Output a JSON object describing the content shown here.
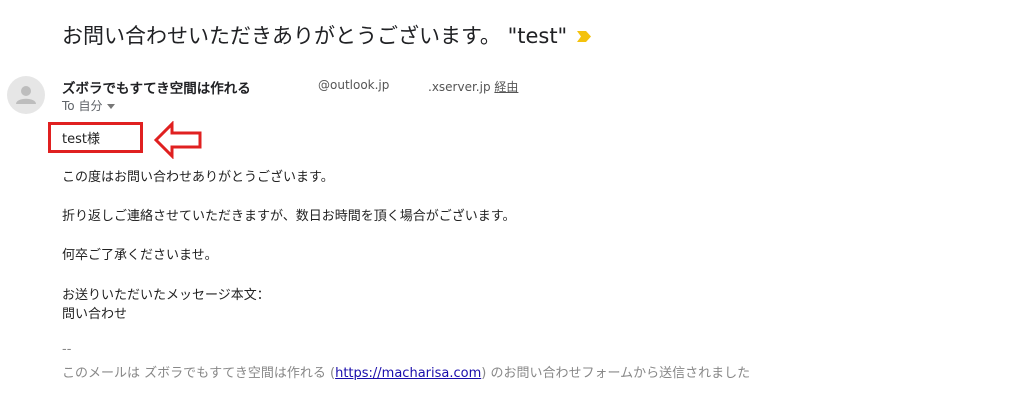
{
  "email": {
    "subject": "お問い合わせいただきありがとうございます。 \"test\"",
    "sender_name": "ズボラでもすてき空間は作れる",
    "sender_address": "@outlook.jp",
    "relay_address": ".xserver.jp",
    "via_label": "経由",
    "to_label": "To 自分"
  },
  "body": {
    "greeting": "test様",
    "line1": "この度はお問い合わせありがとうございます。",
    "line2": "折り返しご連絡させていただきますが、数日お時間を頂く場合がございます。",
    "line3": "何卒ご了承くださいませ。",
    "line4": "お送りいただいたメッセージ本文：",
    "line5": "問い合わせ"
  },
  "signature": {
    "separator": "--",
    "prefix": "このメールは ズボラでもすてき空間は作れる (",
    "link_text": "https://macharisa.com",
    "suffix": ") のお問い合わせフォームから送信されました"
  },
  "colors": {
    "highlight_red": "#e02020",
    "importance_yellow": "#f4c20d",
    "link_blue": "#1a0dab"
  }
}
